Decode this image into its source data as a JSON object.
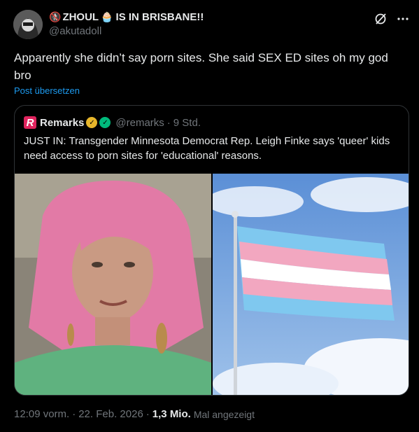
{
  "author": {
    "display_name": "ZHOUL",
    "name_suffix": "IS IN BRISBANE!!",
    "handle": "@akutadoll",
    "emoji_prefix": "🚷",
    "emoji_mid": "🧁"
  },
  "tweet": {
    "text": "Apparently she didn’t say porn sites. She said SEX ED sites oh my god bro",
    "translate_label": "Post übersetzen"
  },
  "quoted": {
    "logo_letter": "R",
    "name": "Remarks",
    "handle": "@remarks",
    "separator": "·",
    "time": "9 Std.",
    "text": "JUST IN: Transgender Minnesota Democrat Rep. Leigh Finke says 'queer' kids need access to porn sites for 'educational' reasons."
  },
  "footer": {
    "time": "12:09 vorm.",
    "dot1": "·",
    "date": "22. Feb. 2026",
    "dot2": "·",
    "views": "1,3 Mio.",
    "views_label": "Mal angezeigt"
  },
  "icons": {
    "grok": "slash-circle-icon",
    "more": "more-icon"
  },
  "colors": {
    "background": "#000000",
    "text": "#e7e9ea",
    "muted": "#71767b",
    "link": "#1d9bf0",
    "border": "#2f3336",
    "flag_blue": "#7fc8ef",
    "flag_pink": "#f2a7c0",
    "flag_white": "#ffffff"
  }
}
